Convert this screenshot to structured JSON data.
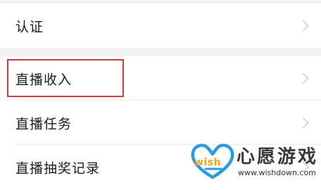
{
  "rows": [
    {
      "label": "认证"
    },
    {
      "label": "直播收入"
    },
    {
      "label": "直播任务"
    },
    {
      "label": "直播抽奖记录"
    }
  ],
  "highlighted_row": "直播收入",
  "colors": {
    "highlight_border": "#cc3c3c",
    "chevron": "#b5b5b5",
    "group_gap": "#f1f1f1"
  },
  "watermark": {
    "logo_word": "wish",
    "title": "心愿游戏",
    "url": "www.wishdown.com"
  }
}
